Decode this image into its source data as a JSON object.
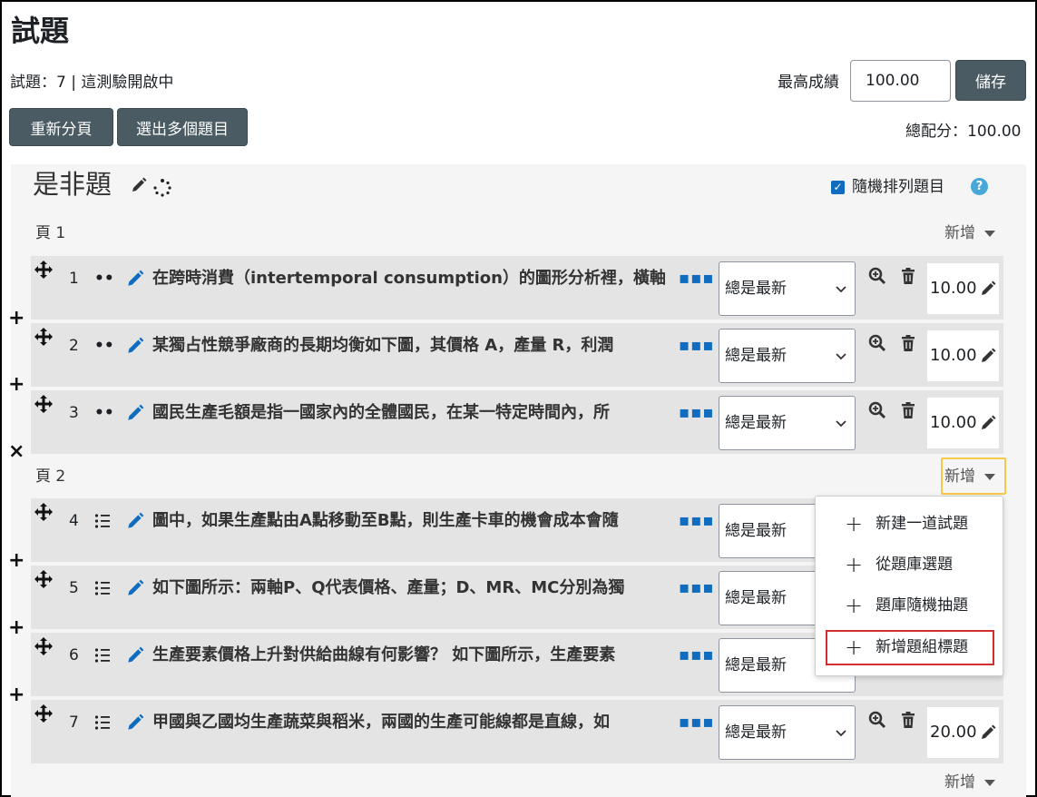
{
  "page": {
    "title": "試題",
    "info": "試題：7 | 這測驗開啟中",
    "max_grade_label": "最高成績",
    "max_grade_value": "100.00",
    "save_label": "儲存",
    "repaginate_label": "重新分頁",
    "select_multiple_label": "選出多個題目",
    "total_marks": "總配分：100.00"
  },
  "section": {
    "heading": "是非題",
    "shuffle_label": "隨機排列題目",
    "shuffle_checked": true,
    "help_icon": "?"
  },
  "pages": [
    {
      "label": "頁 1",
      "add_label": "新增"
    },
    {
      "label": "頁 2",
      "add_label": "新增"
    }
  ],
  "bottom_add_label": "新增",
  "separators": [
    "+",
    "+",
    "×",
    "+",
    "+",
    "+"
  ],
  "questions": [
    {
      "num": "1",
      "type_icon": "••",
      "text": "在跨時消費（intertemporal consumption）的圖形分析裡，橫軸",
      "version": "總是最新",
      "mark": "10.00",
      "show_actions": true
    },
    {
      "num": "2",
      "type_icon": "••",
      "text": "某獨占性競爭廠商的長期均衡如下圖，其價格 A，產量 R，利潤",
      "version": "總是最新",
      "mark": "10.00",
      "show_actions": true
    },
    {
      "num": "3",
      "type_icon": "••",
      "text": "國民生產毛額是指一國家內的全體國民，在某一特定時間內，所",
      "version": "總是最新",
      "mark": "10.00",
      "show_actions": true
    },
    {
      "num": "4",
      "type_icon": "list",
      "text": "圖中，如果生產點由A點移動至B點，則生產卡車的機會成本會隨",
      "version": "總是最新",
      "mark": "",
      "show_actions": false
    },
    {
      "num": "5",
      "type_icon": "list",
      "text": "如下圖所示：兩軸P、Q代表價格、產量；D、MR、MC分別為獨",
      "version": "總是最新",
      "mark": "",
      "show_actions": false
    },
    {
      "num": "6",
      "type_icon": "list",
      "text": "生產要素價格上升對供給曲線有何影響？ 如下圖所示，生產要素",
      "version": "總是最新",
      "mark": "",
      "show_actions": false
    },
    {
      "num": "7",
      "type_icon": "list",
      "text": "甲國與乙國均生產蔬菜與稻米，兩國的生產可能線都是直線，如",
      "version": "總是最新",
      "mark": "20.00",
      "show_actions": true
    }
  ],
  "add_menu": {
    "items": [
      {
        "label": "新建一道試題"
      },
      {
        "label": "從題庫選題"
      },
      {
        "label": "題庫隨機抽題"
      },
      {
        "label": "新增題組標題"
      }
    ]
  },
  "colors": {
    "accent": "#0f6cbf",
    "button_dark": "#4a5b63",
    "slot_bg": "#e4e4e4",
    "highlight_red": "#d32f2f",
    "highlight_yellow": "#f7c948"
  }
}
